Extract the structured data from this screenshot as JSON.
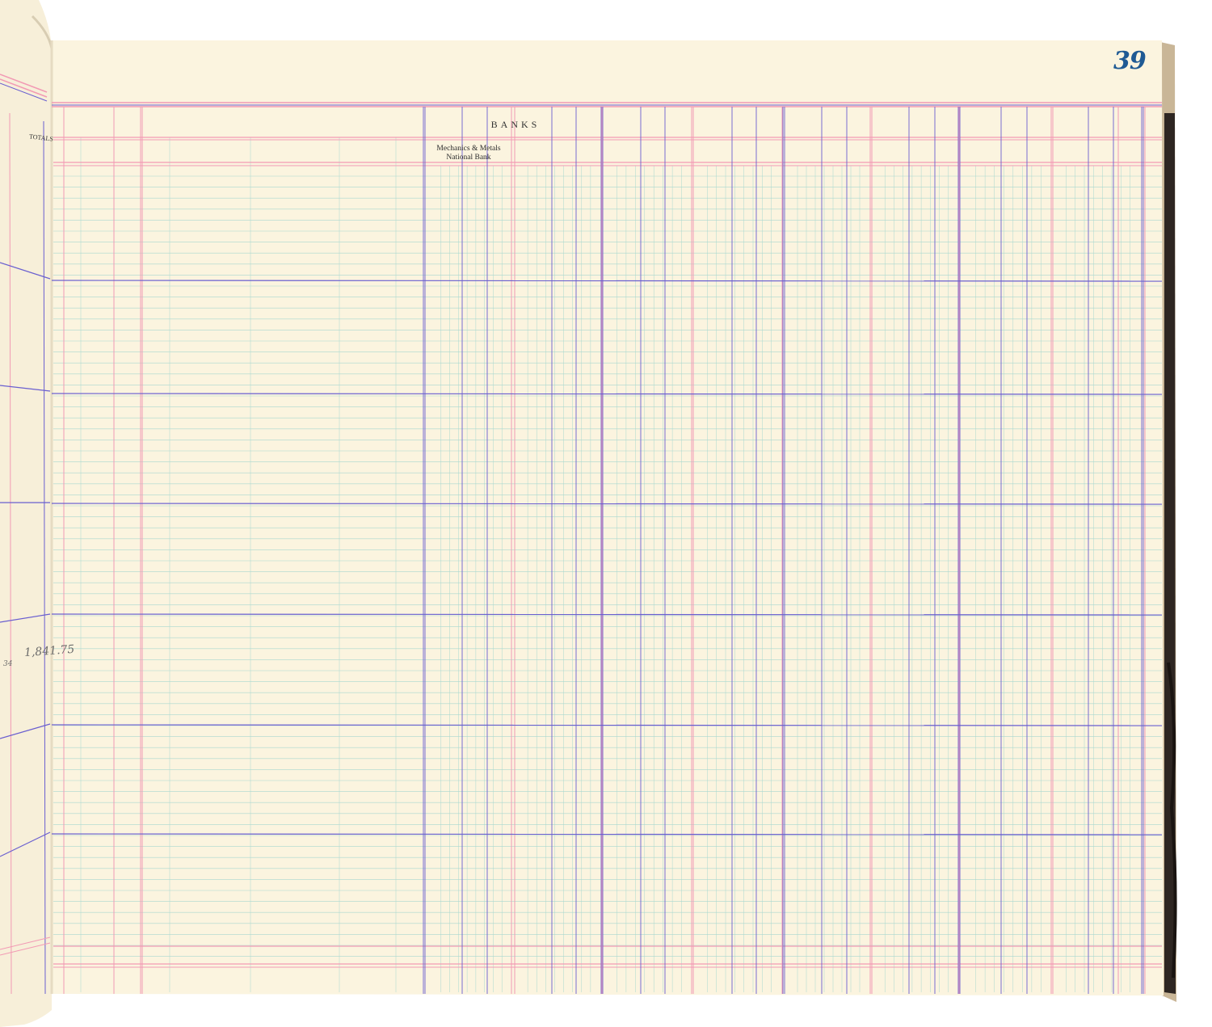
{
  "page_number": "39",
  "header": {
    "group_title": "BANKS",
    "columns": [
      {
        "label_line1": "Mechanics & Metals",
        "label_line2": "National Bank"
      }
    ]
  },
  "left_page": {
    "column_title": "TOTALS",
    "handwritten_fragments": [
      "34",
      "1,841.75"
    ]
  },
  "colors": {
    "paper": "#fbf4df",
    "red_rule": "#f29ab4",
    "blue_rule": "#6a5fd0",
    "green_rule": "#a8d8cf",
    "page_number_ink": "#1f5a94",
    "binding": "#2e2622"
  }
}
